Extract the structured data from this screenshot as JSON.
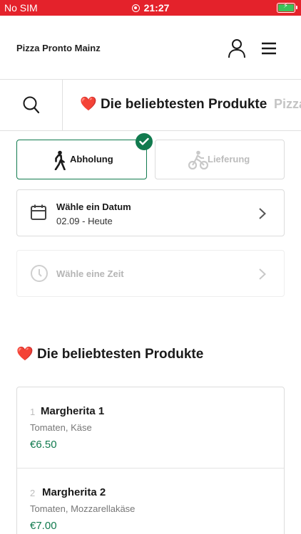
{
  "status_bar": {
    "carrier": "No SIM",
    "time": "21:27",
    "battery_color": "#3cc15a",
    "bar_color": "#e4222b"
  },
  "header": {
    "restaurant_name": "Pizza Pronto Mainz",
    "user_icon": "user-icon",
    "menu_icon": "hamburger-menu-icon"
  },
  "categories": {
    "search_icon": "search-icon",
    "active": {
      "emoji": "❤️",
      "label": "Die beliebtesten Produkte"
    },
    "next": {
      "label": "Pizza"
    }
  },
  "fulfillment": {
    "pickup_label": "Abholung",
    "delivery_label": "Lieferung",
    "selected": "pickup",
    "accent_color": "#117a4e"
  },
  "date_selector": {
    "title": "Wähle ein Datum",
    "value": "02.09 - Heute"
  },
  "time_selector": {
    "title": "Wähle eine Zeit"
  },
  "section": {
    "emoji": "❤️",
    "title": "Die beliebtesten Produkte"
  },
  "products": [
    {
      "number": "1",
      "name": "Margherita 1",
      "description": "Tomaten, Käse",
      "price": "€6.50"
    },
    {
      "number": "2",
      "name": "Margherita 2",
      "description": "Tomaten, Mozzarellakäse",
      "price": "€7.00"
    }
  ]
}
